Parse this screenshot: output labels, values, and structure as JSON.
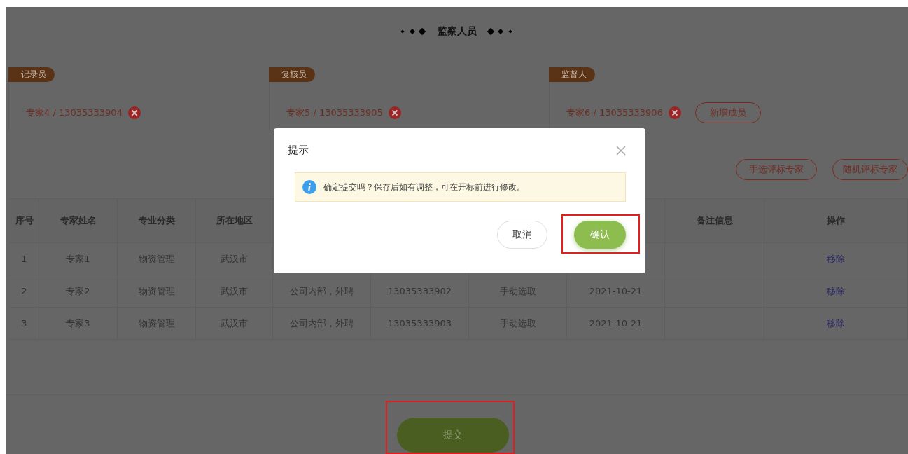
{
  "section_title": "监察人员",
  "roles": [
    {
      "label": "记录员",
      "members": [
        "专家4 / 13035333904"
      ]
    },
    {
      "label": "复核员",
      "members": [
        "专家5 / 13035333905"
      ]
    },
    {
      "label": "监督人",
      "members": [
        "专家6 / 13035333906"
      ],
      "add_label": "新增成员"
    }
  ],
  "actions": [
    "手选评标专家",
    "随机评标专家"
  ],
  "table": {
    "columns": [
      "序号",
      "专家姓名",
      "专业分类",
      "所在地区",
      null,
      null,
      null,
      null,
      "备注信息",
      "操作"
    ],
    "rows": [
      [
        "1",
        "专家1",
        "物资管理",
        "武汉市",
        null,
        null,
        null,
        null,
        null,
        "移除"
      ],
      [
        "2",
        "专家2",
        "物资管理",
        "武汉市",
        "公司内部，外聘",
        "13035333902",
        "手动选取",
        "2021-10-21",
        null,
        "移除"
      ],
      [
        "3",
        "专家3",
        "物资管理",
        "武汉市",
        "公司内部，外聘",
        "13035333903",
        "手动选取",
        "2021-10-21",
        null,
        "移除"
      ]
    ]
  },
  "submit": {
    "label": "提交",
    "highlighted": true
  },
  "dialog": {
    "title": "提示",
    "message": "确定提交吗？保存后如有调整，可在开标前进行修改。",
    "buttons": [
      {
        "label": "取消",
        "kind": "secondary",
        "highlighted": false
      },
      {
        "label": "确认",
        "kind": "primary",
        "highlighted": true
      }
    ]
  }
}
